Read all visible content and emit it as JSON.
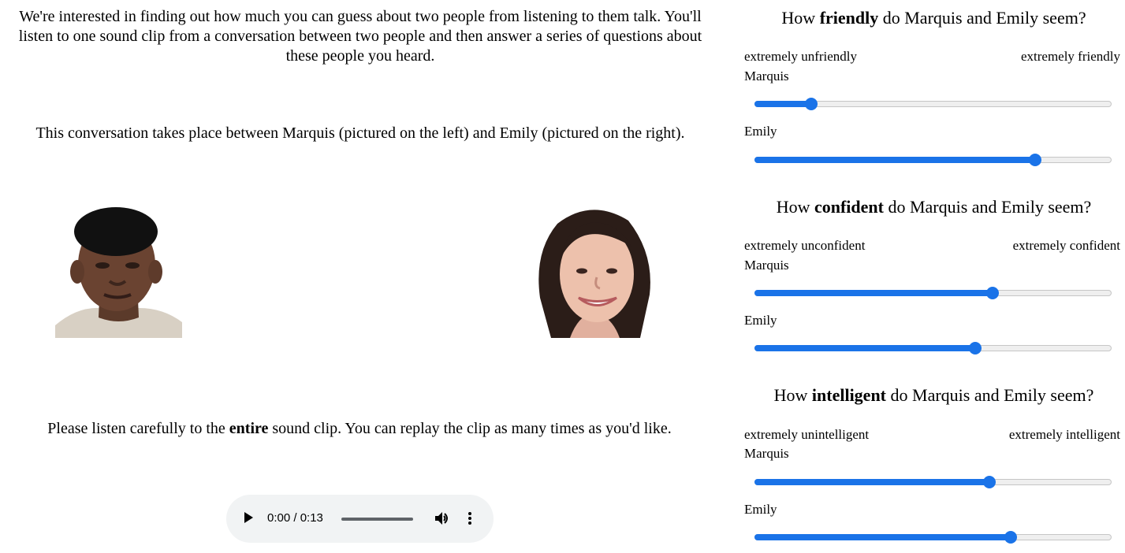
{
  "intro": {
    "paragraph1": "We're interested in finding out how much you can guess about two people from listening to them talk. You'll listen to one sound clip from a conversation between two people and then answer a series of questions about these people you heard.",
    "paragraph2": "This conversation takes place between Marquis (pictured on the left) and Emily (pictured on the right).",
    "instruction_before": "Please listen carefully to the ",
    "instruction_bold": "entire",
    "instruction_after": " sound clip. You can replay the clip as many times as you'd like."
  },
  "audio": {
    "time": "0:00 / 0:13",
    "progress": 0,
    "icons": [
      "play-icon",
      "volume-icon",
      "more-options-icon"
    ]
  },
  "questions": [
    {
      "prefix": "How ",
      "trait": "friendly",
      "suffix": " do Marquis and Emily seem?",
      "left_anchor": "extremely unfriendly",
      "right_anchor": "extremely friendly",
      "ratings": [
        {
          "person": "Marquis",
          "value": 0.16
        },
        {
          "person": "Emily",
          "value": 0.79
        }
      ]
    },
    {
      "prefix": "How ",
      "trait": "confident",
      "suffix": " do Marquis and Emily seem?",
      "left_anchor": "extremely unconfident",
      "right_anchor": "extremely confident",
      "ratings": [
        {
          "person": "Marquis",
          "value": 0.67
        },
        {
          "person": "Emily",
          "value": 0.62
        }
      ]
    },
    {
      "prefix": "How ",
      "trait": "intelligent",
      "suffix": " do Marquis and Emily seem?",
      "left_anchor": "extremely unintelligent",
      "right_anchor": "extremely intelligent",
      "ratings": [
        {
          "person": "Marquis",
          "value": 0.66
        },
        {
          "person": "Emily",
          "value": 0.72
        }
      ]
    }
  ],
  "colors": {
    "slider_fill": "#1a73e8",
    "slider_track": "#efefef",
    "audio_background": "#f1f3f4"
  }
}
